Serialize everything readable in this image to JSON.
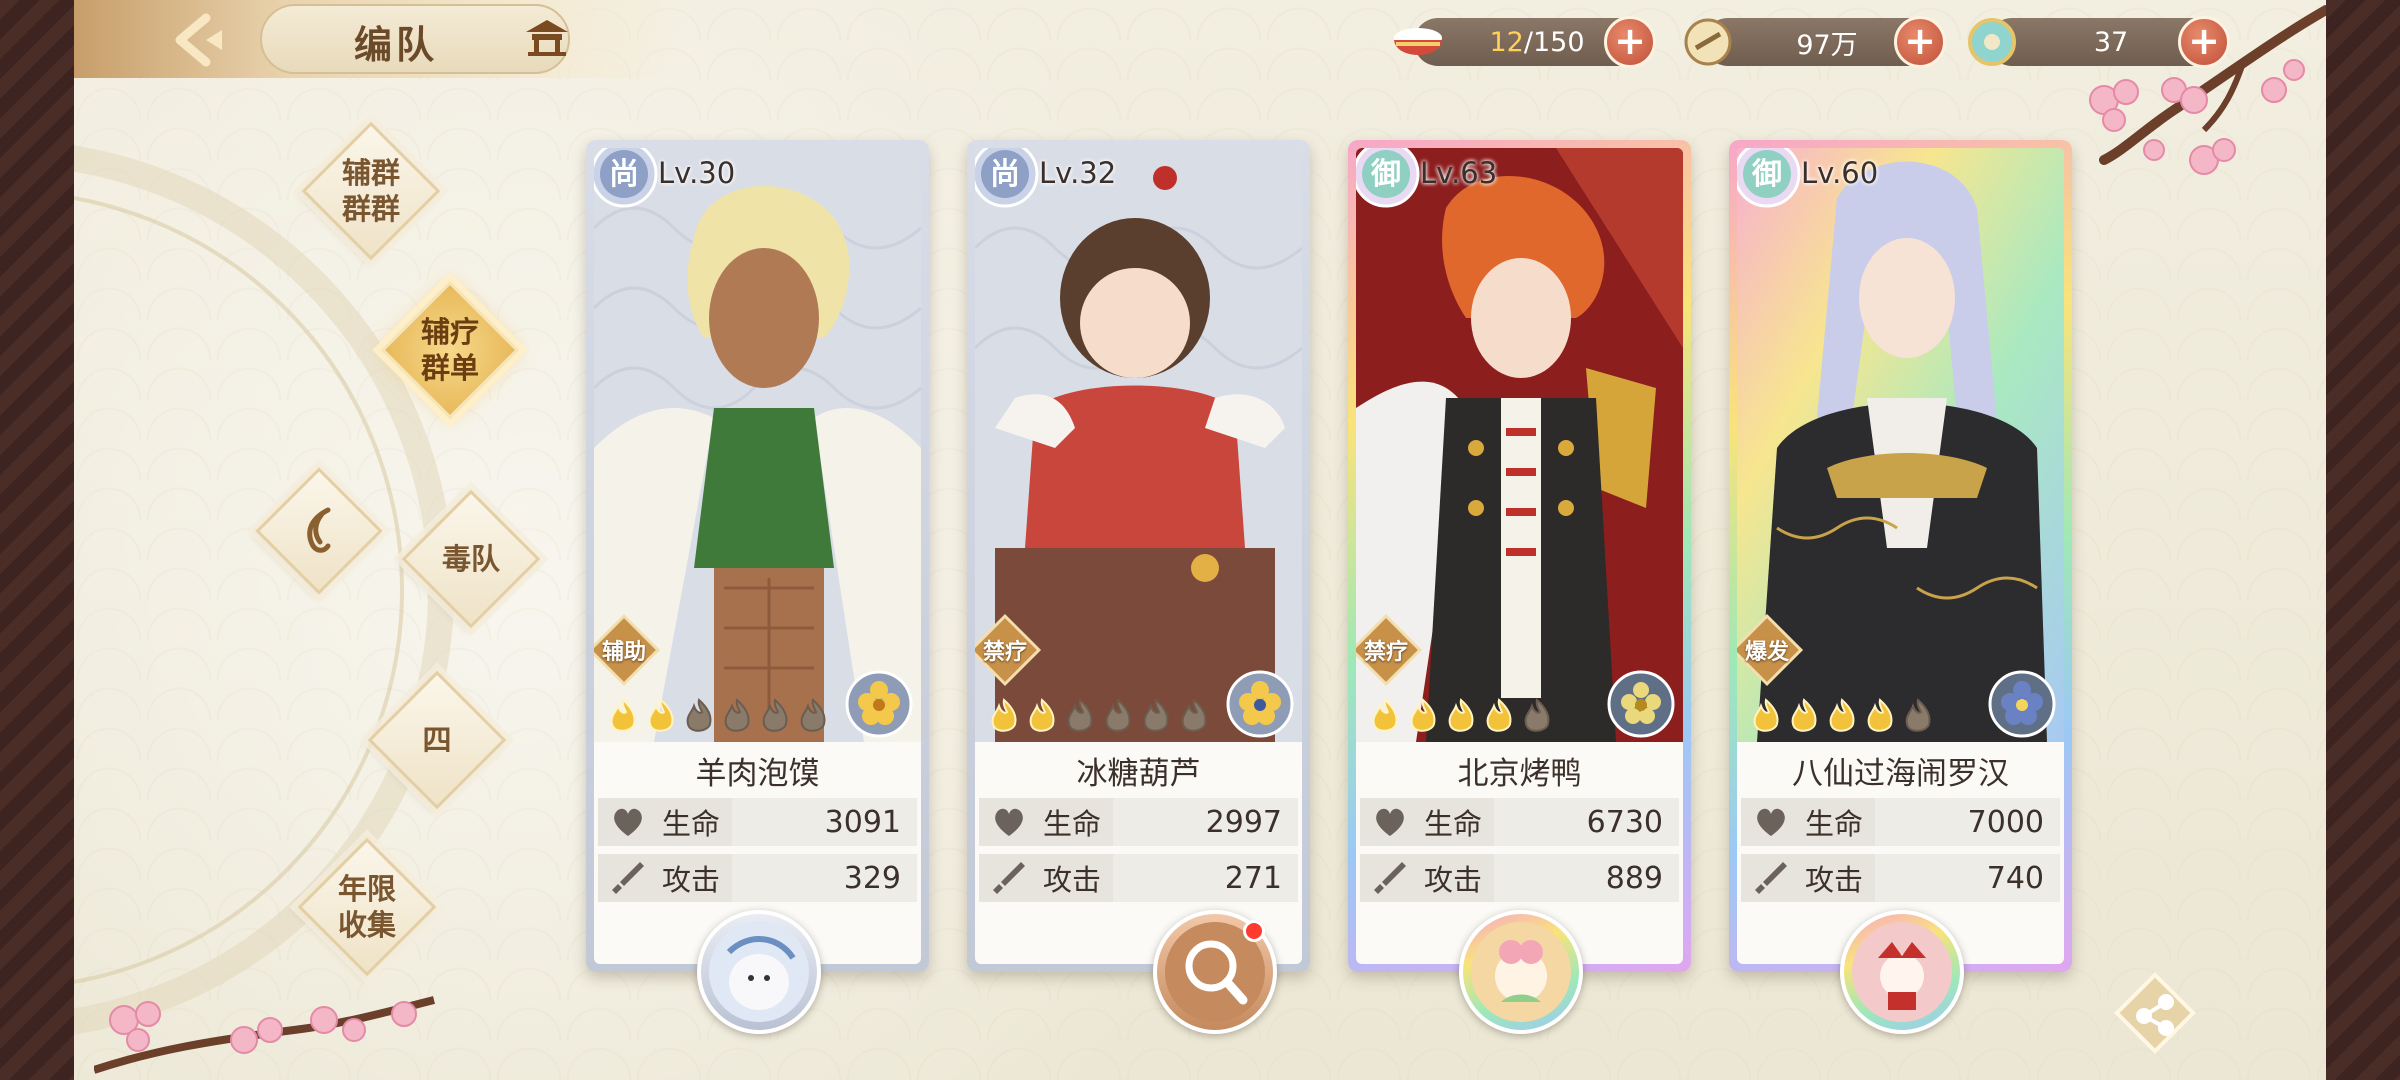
{
  "header": {
    "title": "编队",
    "back_icon": "back-arrow-icon",
    "home_icon": "pavilion-icon"
  },
  "resources": [
    {
      "icon": "bowl-icon",
      "current": "12",
      "total": "/150"
    },
    {
      "icon": "coin-icon",
      "value": "97万"
    },
    {
      "icon": "jade-icon",
      "value": "37"
    }
  ],
  "plus_label": "+",
  "sidebar": {
    "items": [
      {
        "label": "辅群\n群群"
      },
      {
        "label": "辅疗\n群单",
        "active": true
      },
      {
        "label": "",
        "icon": "swirl-icon"
      },
      {
        "label": "毒队"
      },
      {
        "label": "四"
      },
      {
        "label": "年限\n收集"
      }
    ]
  },
  "cards": [
    {
      "rank": "尚",
      "level": "Lv.30",
      "role": "辅助",
      "name": "羊肉泡馍",
      "hp_label": "生命",
      "hp": "3091",
      "atk_label": "攻击",
      "atk": "329",
      "stars_filled": 2,
      "stars_total": 6,
      "frame": "silver"
    },
    {
      "rank": "尚",
      "level": "Lv.32",
      "role": "禁疗",
      "name": "冰糖葫芦",
      "hp_label": "生命",
      "hp": "2997",
      "atk_label": "攻击",
      "atk": "271",
      "stars_filled": 2,
      "stars_total": 6,
      "frame": "silver"
    },
    {
      "rank": "御",
      "level": "Lv.63",
      "role": "禁疗",
      "name": "北京烤鸭",
      "hp_label": "生命",
      "hp": "6730",
      "atk_label": "攻击",
      "atk": "889",
      "stars_filled": 4,
      "stars_total": 5,
      "frame": "rainbow"
    },
    {
      "rank": "御",
      "level": "Lv.60",
      "role": "爆发",
      "name": "八仙过海闹罗汉",
      "hp_label": "生命",
      "hp": "7000",
      "atk_label": "攻击",
      "atk": "740",
      "stars_filled": 4,
      "stars_total": 5,
      "frame": "rainbow"
    }
  ],
  "colors": {
    "accent_gold": "#e8b95b",
    "plus_red": "#c0503a",
    "resource_bg": "#7a6757",
    "notify_red": "#ff3b2f"
  }
}
